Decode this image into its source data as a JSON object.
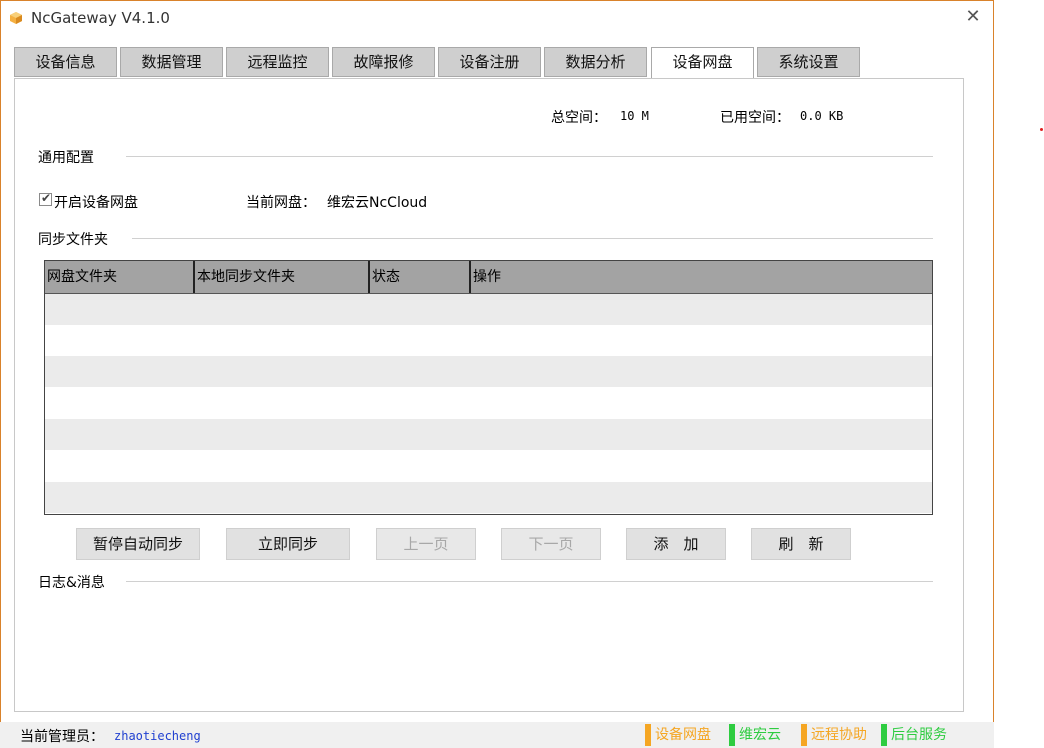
{
  "window": {
    "title": "NcGateway V4.1.0",
    "close_glyph": "✕",
    "accent_color": "#d9822b"
  },
  "tabs": [
    {
      "label": "设备信息",
      "active": false
    },
    {
      "label": "数据管理",
      "active": false
    },
    {
      "label": "远程监控",
      "active": false
    },
    {
      "label": "故障报修",
      "active": false
    },
    {
      "label": "设备注册",
      "active": false
    },
    {
      "label": "数据分析",
      "active": false
    },
    {
      "label": "设备网盘",
      "active": true
    },
    {
      "label": "系统设置",
      "active": false
    }
  ],
  "space": {
    "total_label": "总空间：",
    "total_value": "10 M",
    "used_label": "已用空间：",
    "used_value": "0.0 KB"
  },
  "general": {
    "section_title": "通用配置",
    "enable_checkbox_label": "开启设备网盘",
    "enable_checked": true,
    "current_disk_label": "当前网盘：",
    "current_disk_value": "维宏云NcCloud"
  },
  "sync": {
    "section_title": "同步文件夹",
    "columns": [
      "网盘文件夹",
      "本地同步文件夹",
      "状态",
      "操作"
    ],
    "rows": []
  },
  "buttons": {
    "pause_sync": "暂停自动同步",
    "sync_now": "立即同步",
    "prev_page": "上一页",
    "next_page": "下一页",
    "add": "添　加",
    "refresh": "刷　新"
  },
  "log": {
    "section_title": "日志&消息"
  },
  "statusbar": {
    "admin_label": "当前管理员：",
    "admin_name": "zhaotiecheng",
    "items": [
      {
        "label": "设备网盘",
        "color": "#f5a623"
      },
      {
        "label": "维宏云",
        "color": "#2ecc40"
      },
      {
        "label": "远程协助",
        "color": "#f5a623"
      },
      {
        "label": "后台服务",
        "color": "#2ecc40"
      }
    ]
  }
}
